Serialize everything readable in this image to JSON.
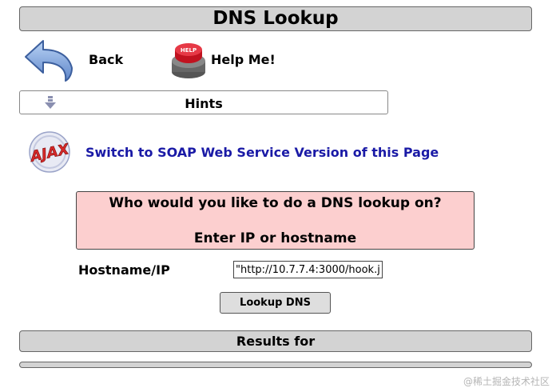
{
  "page": {
    "title": "DNS Lookup"
  },
  "nav": {
    "back_label": "Back",
    "back_icon": "back-arrow-icon",
    "help_label": "Help Me!",
    "help_icon": "help-button-icon",
    "help_icon_text": "HELP"
  },
  "hints": {
    "label": "Hints",
    "icon": "chevron-down-icon"
  },
  "soap": {
    "logo_text": "AJAX",
    "link_label": "Switch to SOAP Web Service Version of this Page",
    "link_color": "#1a1aa6"
  },
  "prompt": {
    "line1": "Who would you like to do a DNS lookup on?",
    "line2": "Enter IP or hostname",
    "background_color": "#fccfcf"
  },
  "form": {
    "hostname_label": "Hostname/IP",
    "hostname_value": "\"http://10.7.7.4:3000/hook.js",
    "submit_label": "Lookup DNS"
  },
  "results": {
    "header": "Results for"
  },
  "watermark": "@稀土掘金技术社区"
}
